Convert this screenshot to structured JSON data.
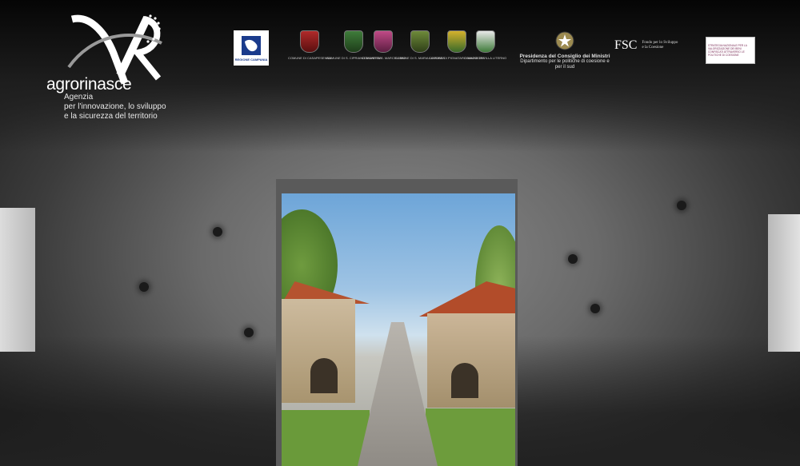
{
  "brand": {
    "name": "agrorinasce",
    "tagline": [
      "Agenzia",
      "per l'innovazione, lo sviluppo",
      "e la sicurezza del territorio"
    ]
  },
  "sponsors": {
    "region": "REGIONE CAMPANIA",
    "municipalities": [
      "COMUNE DI CASAPESENNA",
      "COMUNE DI S. CIPRIANO D'AVERSA",
      "COMUNE DI S. MARCELLINO",
      "COMUNE DI S. MARIA LA FOSSA",
      "COMUNE DI PIGNATARO MAGGIORE",
      "COMUNE DI VILLA LITERNO"
    ],
    "presidency": {
      "title": "Presidenza del Consiglio dei Ministri",
      "subtitle": "Dipartimento per le politiche di coesione e per il sud"
    },
    "fsc": {
      "acronym": "FSC",
      "text": [
        "Fondo per lo Sviluppo",
        "e la Coesione"
      ]
    },
    "strategy": "STRATEGIA NAZIONALE PER LA VALORIZZAZIONE DEI BENI CONFISCATI ATTRAVERSO LE POLITICHE DI COESIONE"
  },
  "colors": {
    "background": "#3c3c3c",
    "brand_text": "#ffffff",
    "sky": "#6da5d8",
    "roof": "#b5532f",
    "grass": "#6a9a3a"
  }
}
